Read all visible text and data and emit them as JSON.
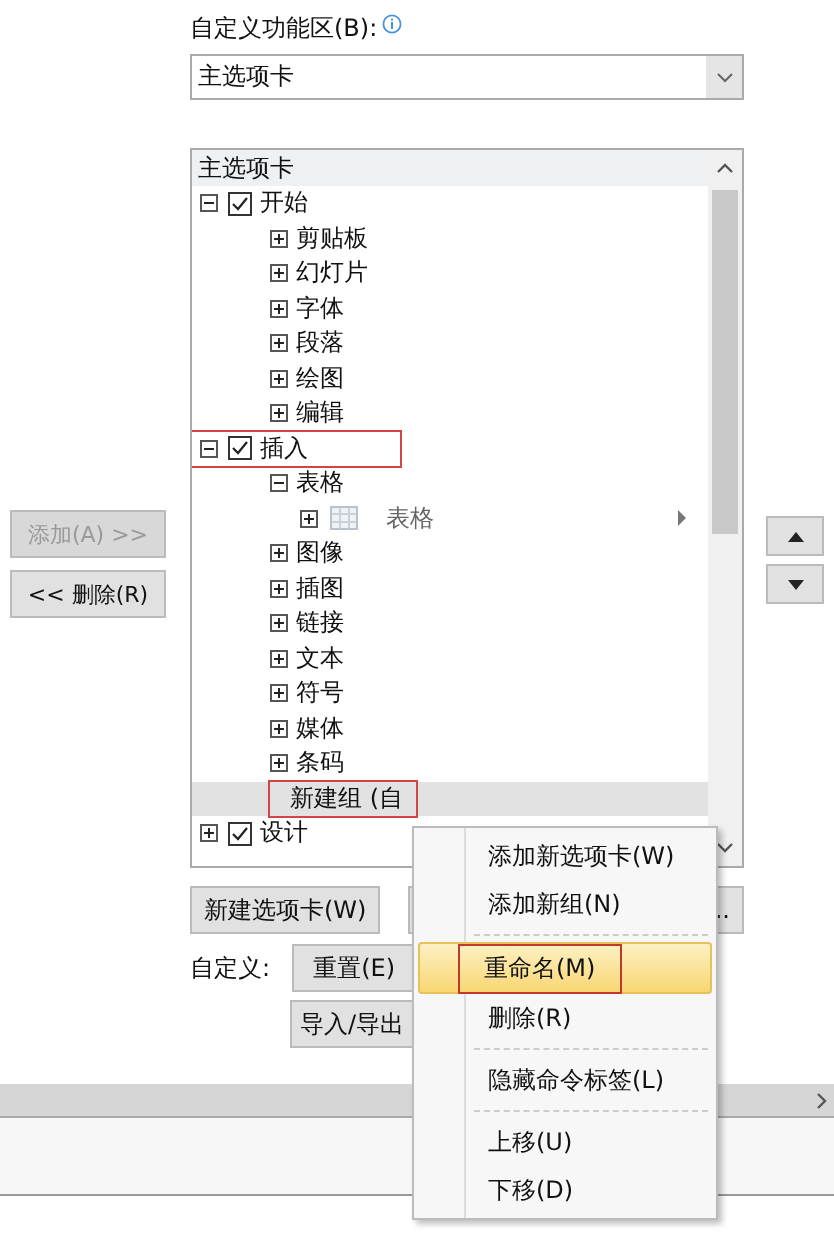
{
  "ribbon_label": "自定义功能区(B):",
  "ribbon_select": {
    "value": "主选项卡"
  },
  "tree": {
    "title": "主选项卡",
    "items": [
      {
        "kind": "tab",
        "label": "开始",
        "checked": true,
        "expanded": true,
        "marked": false,
        "children": [
          {
            "kind": "group",
            "label": "剪贴板",
            "expanded": false
          },
          {
            "kind": "group",
            "label": "幻灯片",
            "expanded": false
          },
          {
            "kind": "group",
            "label": "字体",
            "expanded": false
          },
          {
            "kind": "group",
            "label": "段落",
            "expanded": false
          },
          {
            "kind": "group",
            "label": "绘图",
            "expanded": false
          },
          {
            "kind": "group",
            "label": "编辑",
            "expanded": false
          }
        ]
      },
      {
        "kind": "tab",
        "label": "插入",
        "checked": true,
        "expanded": true,
        "marked": true,
        "children": [
          {
            "kind": "group",
            "label": "表格",
            "expanded": true,
            "children": [
              {
                "kind": "command",
                "label": "表格",
                "expanded": false
              }
            ]
          },
          {
            "kind": "group",
            "label": "图像",
            "expanded": false
          },
          {
            "kind": "group",
            "label": "插图",
            "expanded": false
          },
          {
            "kind": "group",
            "label": "链接",
            "expanded": false
          },
          {
            "kind": "group",
            "label": "文本",
            "expanded": false
          },
          {
            "kind": "group",
            "label": "符号",
            "expanded": false
          },
          {
            "kind": "group",
            "label": "媒体",
            "expanded": false
          },
          {
            "kind": "group",
            "label": "条码",
            "expanded": false
          },
          {
            "kind": "custom-group",
            "label": "新建组 (自",
            "selected": true,
            "marked": true
          }
        ]
      },
      {
        "kind": "tab",
        "label": "设计",
        "checked": true,
        "expanded": false,
        "marked": false
      }
    ]
  },
  "add_button": {
    "label": "添加(A) >>",
    "disabled": true
  },
  "remove_button": {
    "label": "<< 删除(R)",
    "disabled": false
  },
  "new_tab_button": "新建选项卡(W)",
  "hidden_button": "..",
  "customize_label": "自定义:",
  "reset_button": "重置(E)",
  "import_export_button": "导入/导出",
  "context_menu": [
    {
      "kind": "item",
      "label": "添加新选项卡(W)",
      "selected": false,
      "marked": false
    },
    {
      "kind": "item",
      "label": "添加新组(N)",
      "selected": false,
      "marked": false
    },
    {
      "kind": "separator"
    },
    {
      "kind": "item",
      "label": "重命名(M)",
      "selected": true,
      "marked": true
    },
    {
      "kind": "item",
      "label": "删除(R)",
      "selected": false,
      "marked": false
    },
    {
      "kind": "separator"
    },
    {
      "kind": "item",
      "label": "隐藏命令标签(L)",
      "selected": false,
      "marked": false
    },
    {
      "kind": "separator"
    },
    {
      "kind": "item",
      "label": "上移(U)",
      "selected": false,
      "marked": false
    },
    {
      "kind": "item",
      "label": "下移(D)",
      "selected": false,
      "marked": false
    }
  ]
}
